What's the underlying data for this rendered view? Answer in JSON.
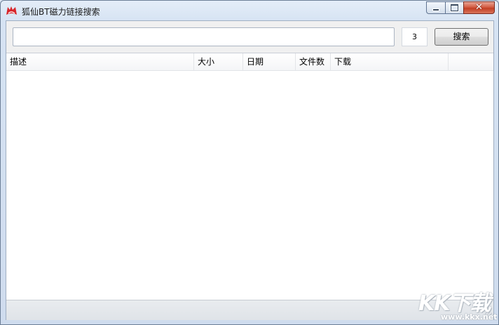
{
  "window": {
    "title": "狐仙BT磁力链接搜索",
    "close_glyph": "✕"
  },
  "toolbar": {
    "search_value": "",
    "search_placeholder": "",
    "count_value": "3",
    "search_button_label": "搜索"
  },
  "table": {
    "columns": [
      "描述",
      "大小",
      "日期",
      "文件数",
      "下载"
    ],
    "rows": []
  },
  "watermark": {
    "logo_text": "KK下载",
    "url": "www.kkx.net"
  },
  "icons": {
    "app": "fox-logo-icon",
    "minimize": "minimize-icon",
    "maximize": "maximize-icon",
    "close": "close-icon"
  },
  "colors": {
    "close_button": "#c33f24",
    "app_icon": "#d8262b"
  }
}
